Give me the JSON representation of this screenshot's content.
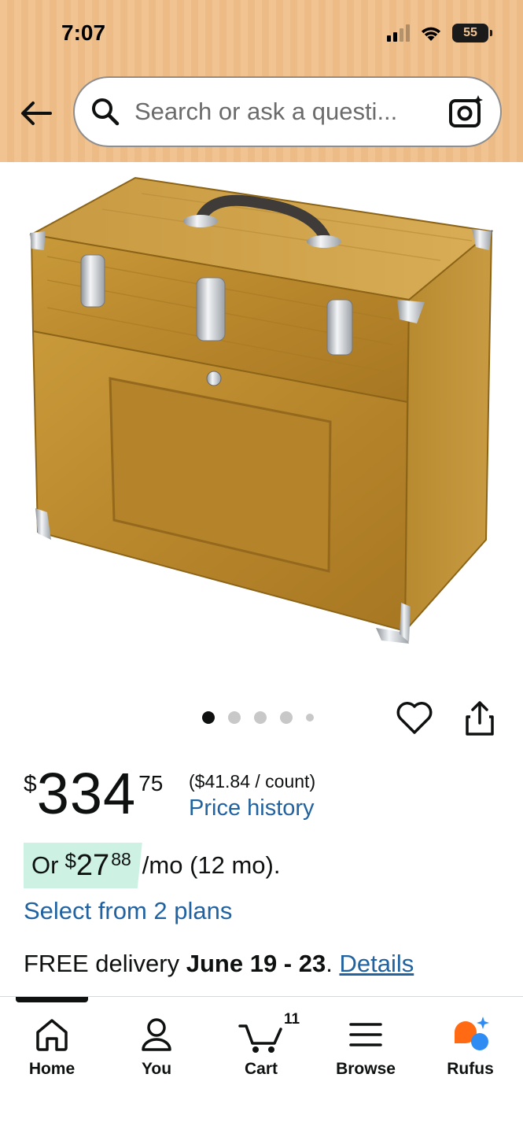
{
  "status_bar": {
    "time": "7:07",
    "battery": "55"
  },
  "search": {
    "placeholder": "Search or ask a questi..."
  },
  "carousel": {
    "total_images": 5,
    "active_index": 0
  },
  "price": {
    "currency": "$",
    "whole": "334",
    "fraction": "75",
    "unit_price": "($41.84 / count)",
    "history_link": "Price history"
  },
  "monthly": {
    "prefix": "Or",
    "currency": "$",
    "amount": "27",
    "cents": "88",
    "suffix": "/mo (12 mo)."
  },
  "plans_link": "Select from 2 plans",
  "delivery": {
    "prefix": "FREE delivery",
    "dates": "June 19 - 23",
    "separator": ".",
    "details_link": "Details"
  },
  "bottom_nav": {
    "items": [
      {
        "label": "Home",
        "icon": "home-icon"
      },
      {
        "label": "You",
        "icon": "person-icon"
      },
      {
        "label": "Cart",
        "icon": "cart-icon",
        "count": "11"
      },
      {
        "label": "Browse",
        "icon": "menu-icon"
      },
      {
        "label": "Rufus",
        "icon": "rufus-icon"
      }
    ],
    "active": "Home"
  },
  "colors": {
    "header_bg": "#f1c391",
    "link": "#2162a1",
    "monthly_badge": "#cdf2e4",
    "text": "#0f1111"
  }
}
